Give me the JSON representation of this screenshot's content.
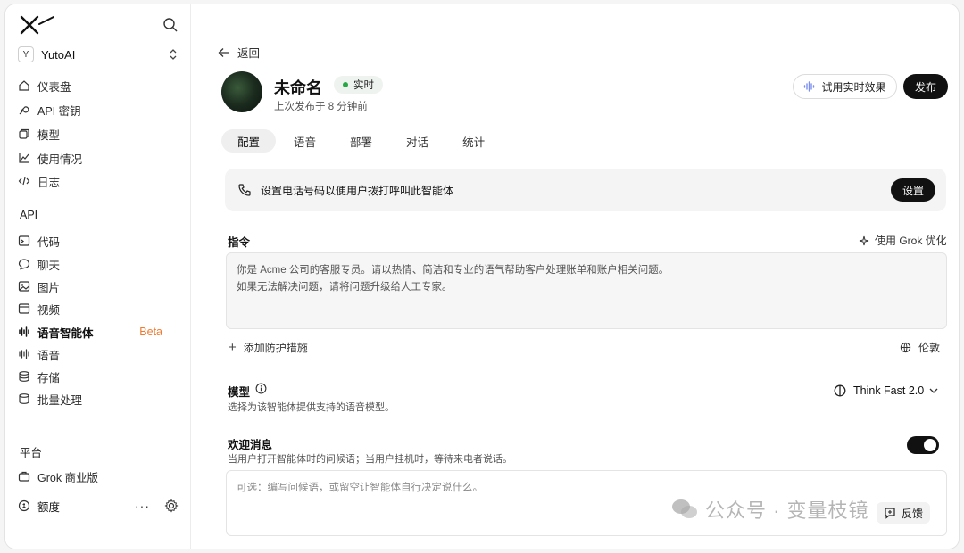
{
  "sidebar": {
    "workspace": {
      "badge": "Y",
      "name": "YutoAI"
    },
    "nav_main": [
      {
        "label": "仪表盘",
        "icon": "home-icon"
      },
      {
        "label": "API 密钥",
        "icon": "key-icon"
      },
      {
        "label": "模型",
        "icon": "cube-icon"
      },
      {
        "label": "使用情况",
        "icon": "chart-line-icon"
      },
      {
        "label": "日志",
        "icon": "code-icon"
      }
    ],
    "api_section": "API",
    "nav_api": [
      {
        "label": "代码",
        "icon": "terminal-icon"
      },
      {
        "label": "聊天",
        "icon": "chat-bubble-icon"
      },
      {
        "label": "图片",
        "icon": "image-icon"
      },
      {
        "label": "视频",
        "icon": "video-icon"
      },
      {
        "label": "语音智能体",
        "icon": "waveform-icon",
        "badge": "Beta",
        "active": true
      },
      {
        "label": "语音",
        "icon": "waveform-small-icon"
      },
      {
        "label": "存储",
        "icon": "database-icon"
      },
      {
        "label": "批量处理",
        "icon": "stack-icon"
      }
    ],
    "platform_section": "平台",
    "nav_platform": [
      {
        "label": "Grok 商业版",
        "icon": "briefcase-icon"
      }
    ],
    "footer": {
      "label": "额度",
      "more": "···"
    }
  },
  "main": {
    "back_label": "返回",
    "agent_name": "未命名",
    "live_label": "实时",
    "published_text": "上次发布于 8 分钟前",
    "try_label": "试用实时效果",
    "publish_label": "发布",
    "tabs": [
      "配置",
      "语音",
      "部署",
      "对话",
      "统计"
    ],
    "active_tab": "配置",
    "phone_banner": {
      "text": "设置电话号码以便用户拨打呼叫此智能体",
      "button": "设置"
    },
    "instructions": {
      "label": "指令",
      "optimize_label": "使用 Grok 优化",
      "line1": "你是 Acme 公司的客服专员。请以热情、简洁和专业的语气帮助客户处理账单和账户相关问题。",
      "line2": "如果无法解决问题，请将问题升级给人工专家。"
    },
    "add_guard_label": "添加防护措施",
    "region_label": "伦敦",
    "model": {
      "label": "模型",
      "desc": "选择为该智能体提供支持的语音模型。",
      "selected": "Think Fast 2.0"
    },
    "welcome": {
      "label": "欢迎消息",
      "desc": "当用户打开智能体时的问候语；当用户挂机时，等待来电者说话。",
      "enabled": true,
      "placeholder": "可选：编写问候语，或留空让智能体自行决定说什么。"
    },
    "feedback_label": "反馈",
    "watermark": "公众号 · 变量枝镜"
  },
  "colors": {
    "accent": "#111111",
    "beta": "#f07a2f",
    "live_dot": "#27a745"
  }
}
